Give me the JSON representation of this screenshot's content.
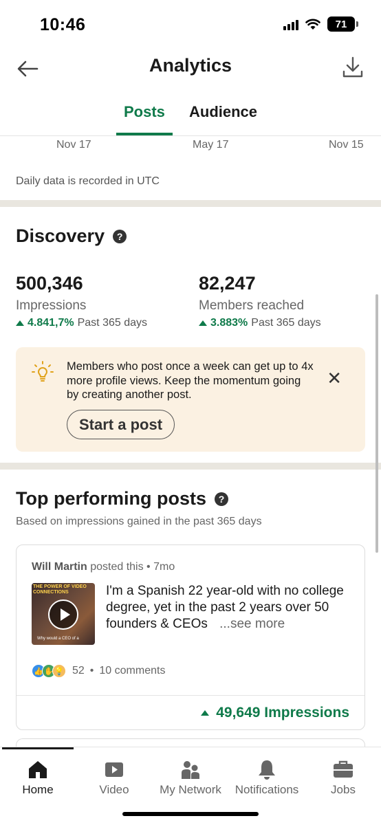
{
  "status_bar": {
    "time": "10:46",
    "battery": "71"
  },
  "header": {
    "title": "Analytics",
    "back_icon": "back-arrow-icon",
    "download_icon": "download-icon"
  },
  "tabs": [
    {
      "label": "Posts",
      "active": true
    },
    {
      "label": "Audience",
      "active": false
    }
  ],
  "chart_axis": {
    "labels": [
      "Nov 17",
      "May 17",
      "Nov 15"
    ]
  },
  "note": "Daily data is recorded in UTC",
  "discovery": {
    "title": "Discovery",
    "metrics": [
      {
        "value": "500,346",
        "label": "Impressions",
        "change": "4.841,7%",
        "period": "Past 365 days"
      },
      {
        "value": "82,247",
        "label": "Members reached",
        "change": "3.883%",
        "period": "Past 365 days"
      }
    ]
  },
  "tip": {
    "text": "Members who post once a week can get up to 4x more profile views. Keep the momentum going by creating another post.",
    "button": "Start a post",
    "close": "✕",
    "icon": "lightbulb-icon"
  },
  "top_posts": {
    "title": "Top performing posts",
    "subtitle": "Based on impressions gained in the past 365 days",
    "posts": [
      {
        "author": "Will Martin",
        "action": "posted this",
        "age": "7mo",
        "thumb_title": "THE POWER OF VIDEO CONNECTIONS",
        "thumb_caption": "Why would a CEO of a",
        "text": "I'm a Spanish 22 year-old with no college degree, yet in the past 2 years over 50 founders & CEOs",
        "see_more": "...see more",
        "reactions_count": "52",
        "comments": "10 comments",
        "impressions": "49,649 Impressions"
      }
    ]
  },
  "bottom_nav": [
    {
      "label": "Home",
      "icon": "home-icon",
      "active": true
    },
    {
      "label": "Video",
      "icon": "video-icon",
      "active": false
    },
    {
      "label": "My Network",
      "icon": "network-icon",
      "active": false
    },
    {
      "label": "Notifications",
      "icon": "bell-icon",
      "active": false
    },
    {
      "label": "Jobs",
      "icon": "briefcase-icon",
      "active": false
    }
  ],
  "colors": {
    "accent": "#0f7a4a",
    "tip_background": "#fbf1e2",
    "divider": "#e9e6df"
  }
}
